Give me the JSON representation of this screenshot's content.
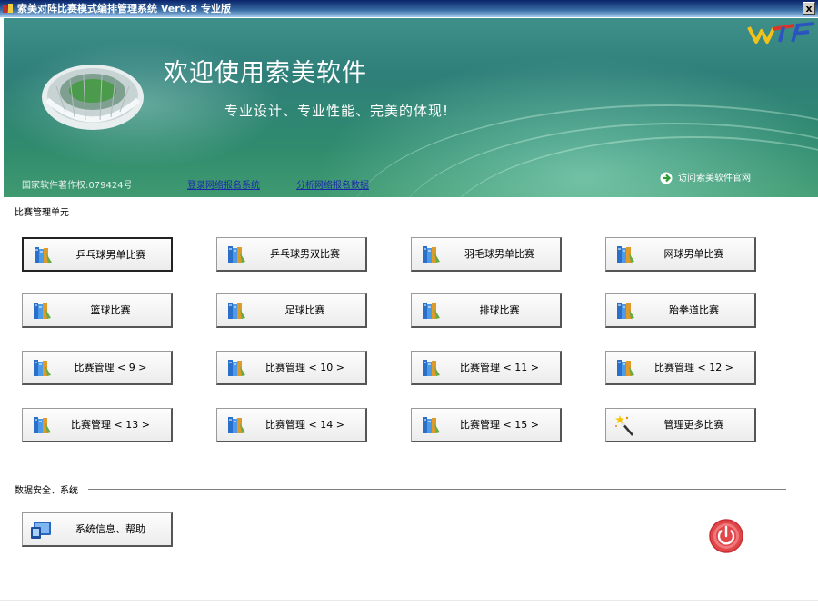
{
  "window": {
    "title": "索美对阵比赛模式编排管理系统 Ver6.8 专业版",
    "close_label": "x"
  },
  "banner": {
    "welcome": "欢迎使用索美软件",
    "slogan": "专业设计、专业性能、完美的体现!",
    "copyright": "国家软件著作权:079424号",
    "link_register": "登录网络报名系统",
    "link_analyze": "分析网络报名数据",
    "visit_site": "访问索美软件官网",
    "logo_text": "WTF"
  },
  "competition_section": {
    "label": "比赛管理单元",
    "buttons": [
      {
        "label": "乒乓球男单比赛",
        "icon": "books-icon"
      },
      {
        "label": "乒乓球男双比赛",
        "icon": "books-icon"
      },
      {
        "label": "羽毛球男单比赛",
        "icon": "books-icon"
      },
      {
        "label": "网球男单比赛",
        "icon": "books-icon"
      },
      {
        "label": "篮球比赛",
        "icon": "books-icon"
      },
      {
        "label": "足球比赛",
        "icon": "books-icon"
      },
      {
        "label": "排球比赛",
        "icon": "books-icon"
      },
      {
        "label": "跆拳道比赛",
        "icon": "books-icon"
      },
      {
        "label": "比赛管理 < 9 >",
        "icon": "books-icon"
      },
      {
        "label": "比赛管理 < 10 >",
        "icon": "books-icon"
      },
      {
        "label": "比赛管理 < 11 >",
        "icon": "books-icon"
      },
      {
        "label": "比赛管理 < 12 >",
        "icon": "books-icon"
      },
      {
        "label": "比赛管理 < 13 >",
        "icon": "books-icon"
      },
      {
        "label": "比赛管理 < 14 >",
        "icon": "books-icon"
      },
      {
        "label": "比赛管理 < 15 >",
        "icon": "books-icon"
      },
      {
        "label": "管理更多比赛",
        "icon": "magic-wand-icon"
      }
    ]
  },
  "system_section": {
    "label": "数据安全、系统",
    "help_button": "系统信息、帮助",
    "help_icon": "monitor-icon",
    "exit_icon": "power-icon"
  },
  "colors": {
    "banner_teal": "#2f7f7a",
    "link_blue": "#1a2aa8",
    "exit_red": "#e0464a"
  }
}
